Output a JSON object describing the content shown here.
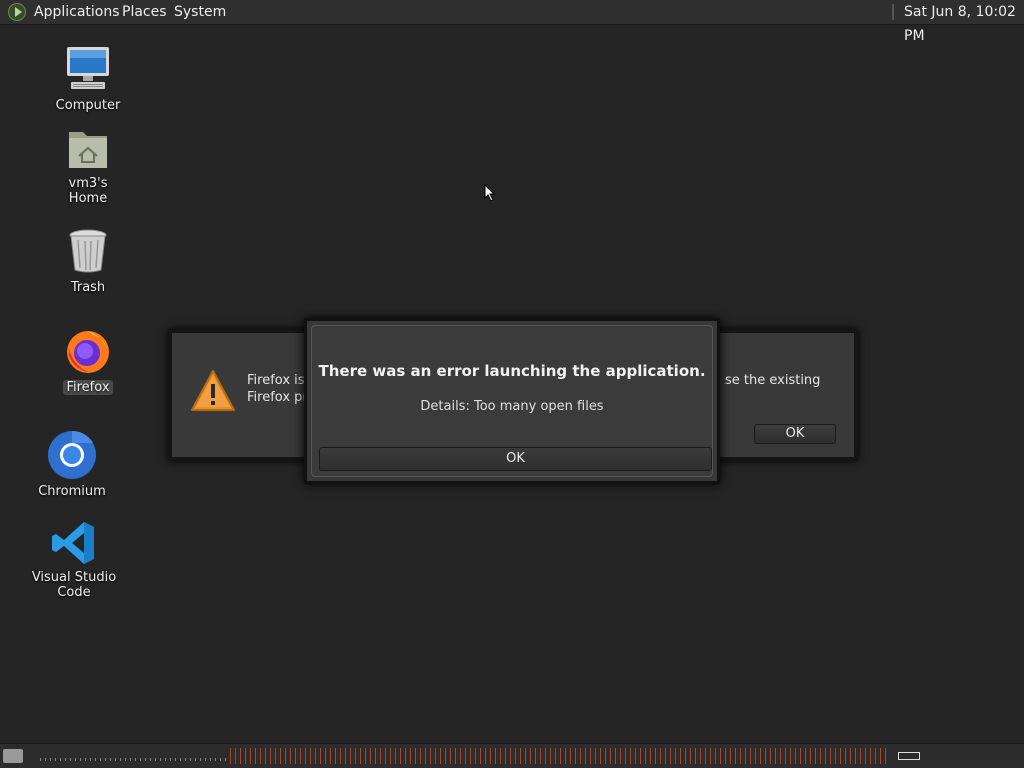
{
  "top_panel": {
    "menus": [
      "Applications",
      "Places",
      "System"
    ],
    "clock": "Sat Jun  8, 10:02 PM"
  },
  "desktop_icons": [
    {
      "label": "Computer",
      "icon": "computer-icon"
    },
    {
      "label": "vm3's Home",
      "icon": "home-folder-icon"
    },
    {
      "label": "Trash",
      "icon": "trash-icon"
    },
    {
      "label": "Firefox",
      "icon": "firefox-icon"
    },
    {
      "label": "Chromium",
      "icon": "chromium-icon"
    },
    {
      "label": "Visual Studio Code",
      "icon": "vscode-icon"
    }
  ],
  "bg_dialog": {
    "text_left_1": "Firefox is",
    "text_left_2": "Firefox pr",
    "text_right": "se the existing",
    "ok_label": "OK",
    "icon": "warning-icon"
  },
  "error_dialog": {
    "title": "There was an error launching the application.",
    "details": "Details: Too many open files",
    "ok_label": "OK"
  },
  "colors": {
    "desktop_bg": "#252525",
    "panel_bg": "#2f2f2f",
    "warning": "#e8902a"
  }
}
